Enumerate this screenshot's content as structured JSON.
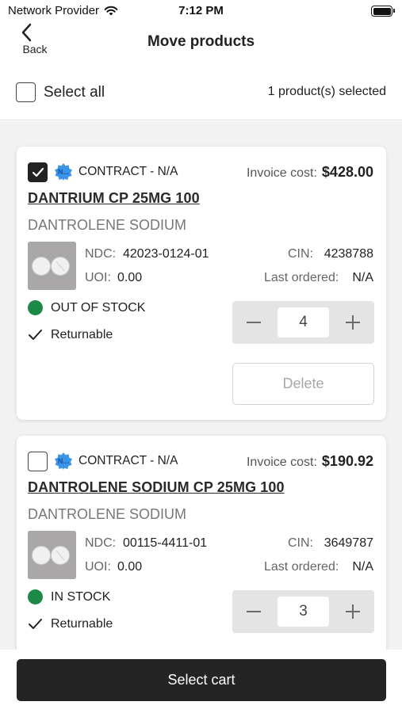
{
  "status_bar": {
    "carrier": "Network Provider",
    "time": "7:12 PM"
  },
  "nav": {
    "back_label": "Back",
    "title": "Move products"
  },
  "select_bar": {
    "select_all_label": "Select all",
    "selected_count": "1 product(s) selected"
  },
  "labels": {
    "invoice_cost": "Invoice cost:",
    "ndc": "NDC:",
    "uoi": "UOI:",
    "cin": "CIN:",
    "last_ordered": "Last ordered:",
    "returnable": "Returnable",
    "delete": "Delete",
    "badge": "N..."
  },
  "products": [
    {
      "checked": true,
      "contract": "CONTRACT - N/A",
      "invoice_cost": "$428.00",
      "name": "DANTRIUM CP 25MG 100",
      "generic": "DANTROLENE SODIUM",
      "ndc": "42023-0124-01",
      "uoi": "0.00",
      "cin": "4238788",
      "last_ordered": "N/A",
      "stock_status": "OUT OF STOCK",
      "quantity": "4"
    },
    {
      "checked": false,
      "contract": "CONTRACT - N/A",
      "invoice_cost": "$190.92",
      "name": "DANTROLENE SODIUM CP 25MG 100",
      "generic": "DANTROLENE SODIUM",
      "ndc": "00115-4411-01",
      "uoi": "0.00",
      "cin": "3649787",
      "last_ordered": "N/A",
      "stock_status": "IN STOCK",
      "quantity": "3"
    }
  ],
  "footer": {
    "select_cart_label": "Select cart"
  },
  "colors": {
    "stock_dot": "#1c8a46",
    "primary_button": "#242424",
    "badge": "#2f8de4"
  }
}
